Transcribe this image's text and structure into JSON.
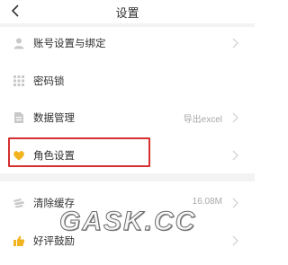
{
  "header": {
    "title": "设置"
  },
  "settings": {
    "items": [
      {
        "label": "账号设置与绑定",
        "value": "",
        "icon": "user-icon"
      },
      {
        "label": "密码锁",
        "value": "",
        "icon": "grid-lock-icon"
      },
      {
        "label": "数据管理",
        "value": "导出excel",
        "icon": "document-icon"
      },
      {
        "label": "角色设置",
        "value": "",
        "icon": "heart-icon"
      },
      {
        "label": "清除缓存",
        "value": "16.08M",
        "icon": "broom-icon"
      },
      {
        "label": "好评鼓励",
        "value": "",
        "icon": "thumbs-up-icon"
      }
    ]
  },
  "watermark": {
    "text": "GASK.CC"
  },
  "colors": {
    "highlight_border": "#d62f2f",
    "heart_icon": "#f2b320",
    "thumbs_icon": "#f2b320",
    "gray_icon": "#c9c9c9",
    "separator": "#f3f3f3"
  }
}
